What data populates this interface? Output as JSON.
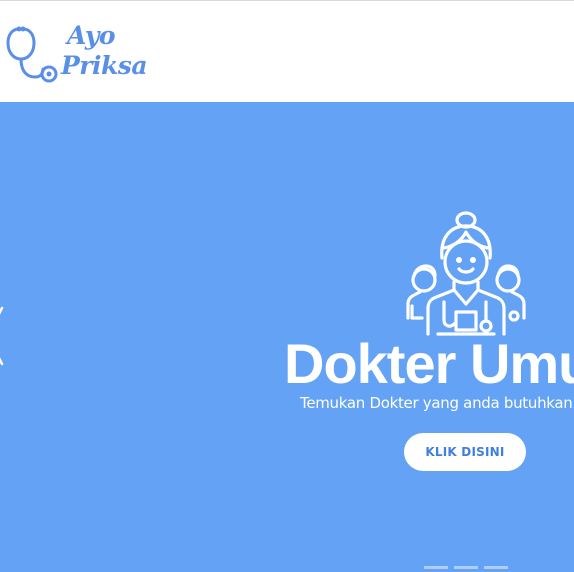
{
  "header": {
    "logo": {
      "line1": "Ayo",
      "line2": "Priksa",
      "icon": "stethoscope-icon",
      "color": "#5a8fe8"
    }
  },
  "hero": {
    "background": "#63a2f4",
    "icon": "doctor-team-icon",
    "title": "Dokter Umum",
    "subtitle": "Temukan Dokter yang anda butuhkan",
    "button_label": "KLIK DISINI",
    "indicator_count": 3
  }
}
